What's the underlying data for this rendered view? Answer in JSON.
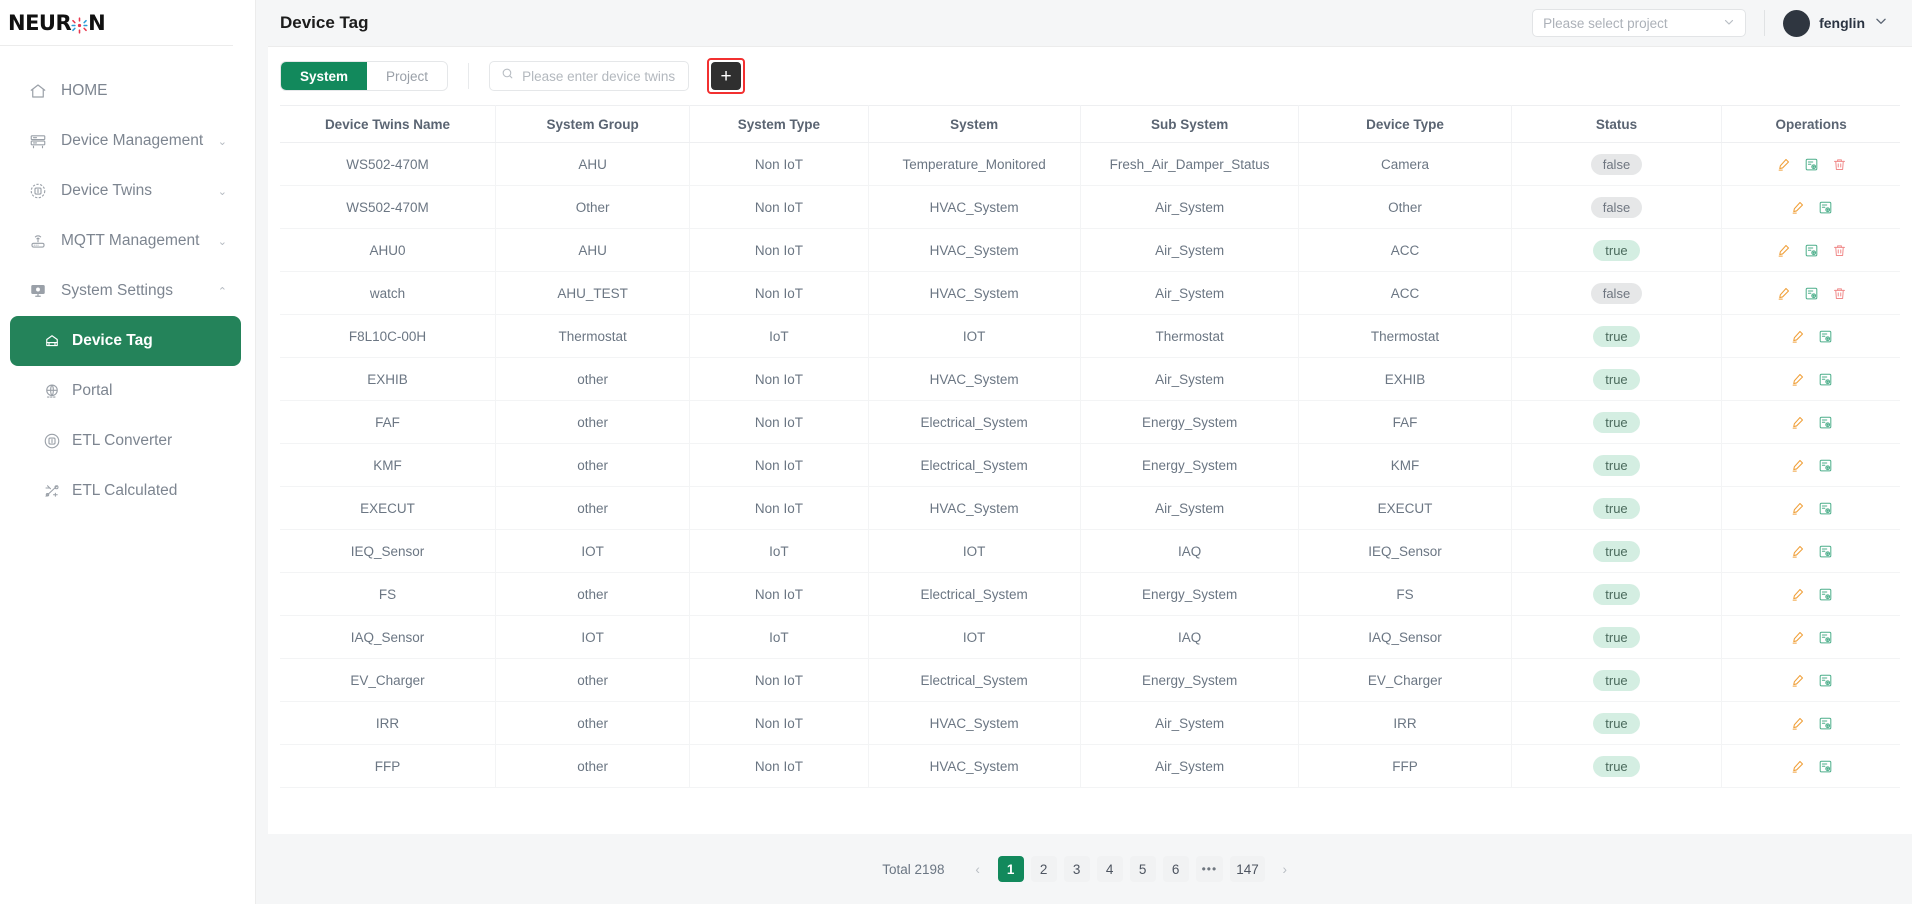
{
  "brand": {
    "text_before": "NEUR",
    "text_after": "N",
    "logo_icon": "neuron-flower-icon"
  },
  "sidebar": {
    "items": [
      {
        "label": "HOME",
        "icon": "home-icon",
        "expandable": false
      },
      {
        "label": "Device Management",
        "icon": "server-icon",
        "expandable": true,
        "chevron": "⌄"
      },
      {
        "label": "Device Twins",
        "icon": "twins-icon",
        "expandable": true,
        "chevron": "⌄"
      },
      {
        "label": "MQTT Management",
        "icon": "router-icon",
        "expandable": true,
        "chevron": "⌄"
      },
      {
        "label": "System Settings",
        "icon": "monitor-icon",
        "expandable": true,
        "chevron": "⌃"
      }
    ],
    "sub_items": [
      {
        "label": "Device Tag",
        "icon": "tag-icon",
        "active": true
      },
      {
        "label": "Portal",
        "icon": "globe-icon",
        "active": false
      },
      {
        "label": "ETL Converter",
        "icon": "converter-icon",
        "active": false
      },
      {
        "label": "ETL Calculated",
        "icon": "calculated-icon",
        "active": false
      }
    ]
  },
  "header": {
    "title": "Device Tag",
    "project_select": {
      "placeholder": "Please select project",
      "chevron_icon": "chevron-down-icon"
    },
    "user": {
      "name": "fenglin",
      "avatar_icon": "avatar-icon",
      "chevron_icon": "chevron-down-icon"
    }
  },
  "toolbar": {
    "tabs": [
      {
        "label": "System",
        "active": true
      },
      {
        "label": "Project",
        "active": false
      }
    ],
    "search": {
      "placeholder": "Please enter device twins name",
      "value": "",
      "icon": "search-icon"
    },
    "add_button": {
      "label": "+",
      "icon": "plus-icon",
      "highlighted": true,
      "highlight_color": "#f23030"
    }
  },
  "table": {
    "columns": [
      "Device Twins Name",
      "System Group",
      "System Type",
      "System",
      "Sub System",
      "Device Type",
      "Status",
      "Operations"
    ],
    "rows": [
      {
        "name": "WS502-470M",
        "group": "AHU",
        "type": "Non IoT",
        "system": "Temperature_Monitored",
        "sub": "Fresh_Air_Damper_Status",
        "device": "Camera",
        "status": "false",
        "ops": [
          "edit-icon",
          "detail-icon",
          "delete-icon"
        ]
      },
      {
        "name": "WS502-470M",
        "group": "Other",
        "type": "Non IoT",
        "system": "HVAC_System",
        "sub": "Air_System",
        "device": "Other",
        "status": "false",
        "ops": [
          "edit-icon",
          "detail-icon"
        ]
      },
      {
        "name": "AHU0",
        "group": "AHU",
        "type": "Non IoT",
        "system": "HVAC_System",
        "sub": "Air_System",
        "device": "ACC",
        "status": "true",
        "ops": [
          "edit-icon",
          "detail-icon",
          "delete-icon"
        ]
      },
      {
        "name": "watch",
        "group": "AHU_TEST",
        "type": "Non IoT",
        "system": "HVAC_System",
        "sub": "Air_System",
        "device": "ACC",
        "status": "false",
        "ops": [
          "edit-icon",
          "detail-icon",
          "delete-icon"
        ]
      },
      {
        "name": "F8L10C-00H",
        "group": "Thermostat",
        "type": "IoT",
        "system": "IOT",
        "sub": "Thermostat",
        "device": "Thermostat",
        "status": "true",
        "ops": [
          "edit-icon",
          "detail-icon"
        ]
      },
      {
        "name": "EXHIB",
        "group": "other",
        "type": "Non IoT",
        "system": "HVAC_System",
        "sub": "Air_System",
        "device": "EXHIB",
        "status": "true",
        "ops": [
          "edit-icon",
          "detail-icon"
        ]
      },
      {
        "name": "FAF",
        "group": "other",
        "type": "Non IoT",
        "system": "Electrical_System",
        "sub": "Energy_System",
        "device": "FAF",
        "status": "true",
        "ops": [
          "edit-icon",
          "detail-icon"
        ]
      },
      {
        "name": "KMF",
        "group": "other",
        "type": "Non IoT",
        "system": "Electrical_System",
        "sub": "Energy_System",
        "device": "KMF",
        "status": "true",
        "ops": [
          "edit-icon",
          "detail-icon"
        ]
      },
      {
        "name": "EXECUT",
        "group": "other",
        "type": "Non IoT",
        "system": "HVAC_System",
        "sub": "Air_System",
        "device": "EXECUT",
        "status": "true",
        "ops": [
          "edit-icon",
          "detail-icon"
        ]
      },
      {
        "name": "IEQ_Sensor",
        "group": "IOT",
        "type": "IoT",
        "system": "IOT",
        "sub": "IAQ",
        "device": "IEQ_Sensor",
        "status": "true",
        "ops": [
          "edit-icon",
          "detail-icon"
        ]
      },
      {
        "name": "FS",
        "group": "other",
        "type": "Non IoT",
        "system": "Electrical_System",
        "sub": "Energy_System",
        "device": "FS",
        "status": "true",
        "ops": [
          "edit-icon",
          "detail-icon"
        ]
      },
      {
        "name": "IAQ_Sensor",
        "group": "IOT",
        "type": "IoT",
        "system": "IOT",
        "sub": "IAQ",
        "device": "IAQ_Sensor",
        "status": "true",
        "ops": [
          "edit-icon",
          "detail-icon"
        ]
      },
      {
        "name": "EV_Charger",
        "group": "other",
        "type": "Non IoT",
        "system": "Electrical_System",
        "sub": "Energy_System",
        "device": "EV_Charger",
        "status": "true",
        "ops": [
          "edit-icon",
          "detail-icon"
        ]
      },
      {
        "name": "IRR",
        "group": "other",
        "type": "Non IoT",
        "system": "HVAC_System",
        "sub": "Air_System",
        "device": "IRR",
        "status": "true",
        "ops": [
          "edit-icon",
          "detail-icon"
        ]
      },
      {
        "name": "FFP",
        "group": "other",
        "type": "Non IoT",
        "system": "HVAC_System",
        "sub": "Air_System",
        "device": "FFP",
        "status": "true",
        "ops": [
          "edit-icon",
          "detail-icon"
        ]
      }
    ]
  },
  "pagination": {
    "total_label": "Total 2198",
    "prev_icon": "‹",
    "next_icon": "›",
    "pages": [
      "1",
      "2",
      "3",
      "4",
      "5",
      "6"
    ],
    "ellipsis": "•••",
    "last_page": "147",
    "current": "1"
  },
  "colors": {
    "accent_green": "#12895c",
    "sidebar_active": "#24835a",
    "highlight_red": "#f23030",
    "edit_icon": "#f0a13c",
    "detail_icon": "#4cae8a",
    "delete_icon": "#f08a8a"
  }
}
